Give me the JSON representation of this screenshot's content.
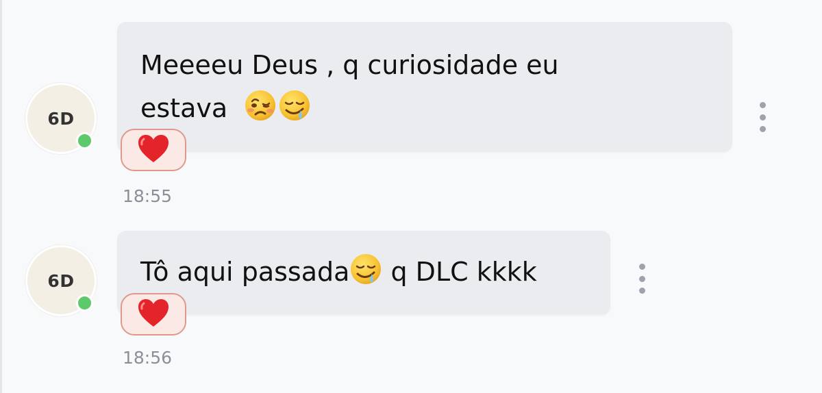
{
  "colors": {
    "background": "#f8f9fb",
    "bubble": "#ebecf0",
    "avatar_bg": "#f3efe5",
    "online": "#5cc96a",
    "reaction_bg": "#fbe9e5",
    "reaction_border": "#e0988a",
    "timestamp": "#8a8f98"
  },
  "messages": [
    {
      "avatar": {
        "initials": "6D",
        "status": "online"
      },
      "text_line1": "Meeeeu Deus , q curiosidade eu",
      "text_line2": "estava",
      "emojis": [
        "woozy-face",
        "drooling-face"
      ],
      "reaction": "red-heart",
      "time": "18:55"
    },
    {
      "avatar": {
        "initials": "6D",
        "status": "online"
      },
      "text_before_emoji": "Tô aqui passada",
      "emoji": "drooling-face",
      "text_after_emoji": " q DLC kkkk",
      "reaction": "red-heart",
      "time": "18:56"
    }
  ]
}
